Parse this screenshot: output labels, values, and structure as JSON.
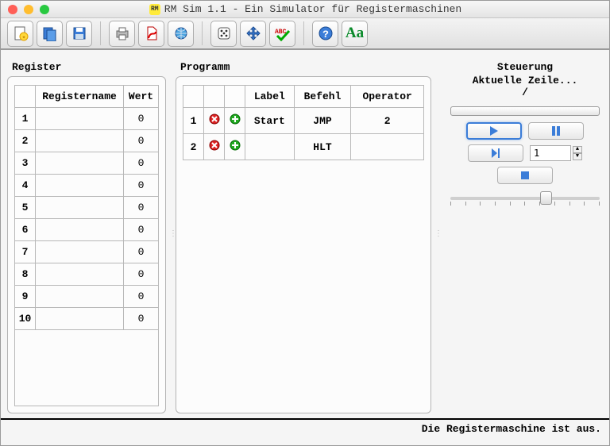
{
  "window": {
    "title": "RM Sim 1.1 - Ein Simulator für Registermaschinen",
    "appBadge": "RM"
  },
  "toolbar": {
    "new": "new-icon",
    "open": "open-icon",
    "save": "save-icon",
    "print": "print-icon",
    "pdf": "pdf-icon",
    "web": "web-icon",
    "dice": "dice-icon",
    "move": "move-icon",
    "spellcheck": "spellcheck-icon",
    "help": "help-icon",
    "font": "font-icon"
  },
  "register": {
    "title": "Register",
    "cols": {
      "name": "Registername",
      "value": "Wert",
      "num": ""
    },
    "rows": [
      {
        "n": "1",
        "name": "",
        "value": "0"
      },
      {
        "n": "2",
        "name": "",
        "value": "0"
      },
      {
        "n": "3",
        "name": "",
        "value": "0"
      },
      {
        "n": "4",
        "name": "",
        "value": "0"
      },
      {
        "n": "5",
        "name": "",
        "value": "0"
      },
      {
        "n": "6",
        "name": "",
        "value": "0"
      },
      {
        "n": "7",
        "name": "",
        "value": "0"
      },
      {
        "n": "8",
        "name": "",
        "value": "0"
      },
      {
        "n": "9",
        "name": "",
        "value": "0"
      },
      {
        "n": "10",
        "name": "",
        "value": "0"
      }
    ]
  },
  "program": {
    "title": "Programm",
    "cols": {
      "label": "Label",
      "command": "Befehl",
      "operator": "Operator"
    },
    "rows": [
      {
        "n": "1",
        "label": "Start",
        "command": "JMP",
        "operator": "2"
      },
      {
        "n": "2",
        "label": "",
        "command": "HLT",
        "operator": ""
      }
    ]
  },
  "control": {
    "title": "Steuerung",
    "currentLine": "Aktuelle Zeile...",
    "separator": "/",
    "stepValue": "1"
  },
  "status": {
    "text": "Die Registermaschine ist aus."
  }
}
